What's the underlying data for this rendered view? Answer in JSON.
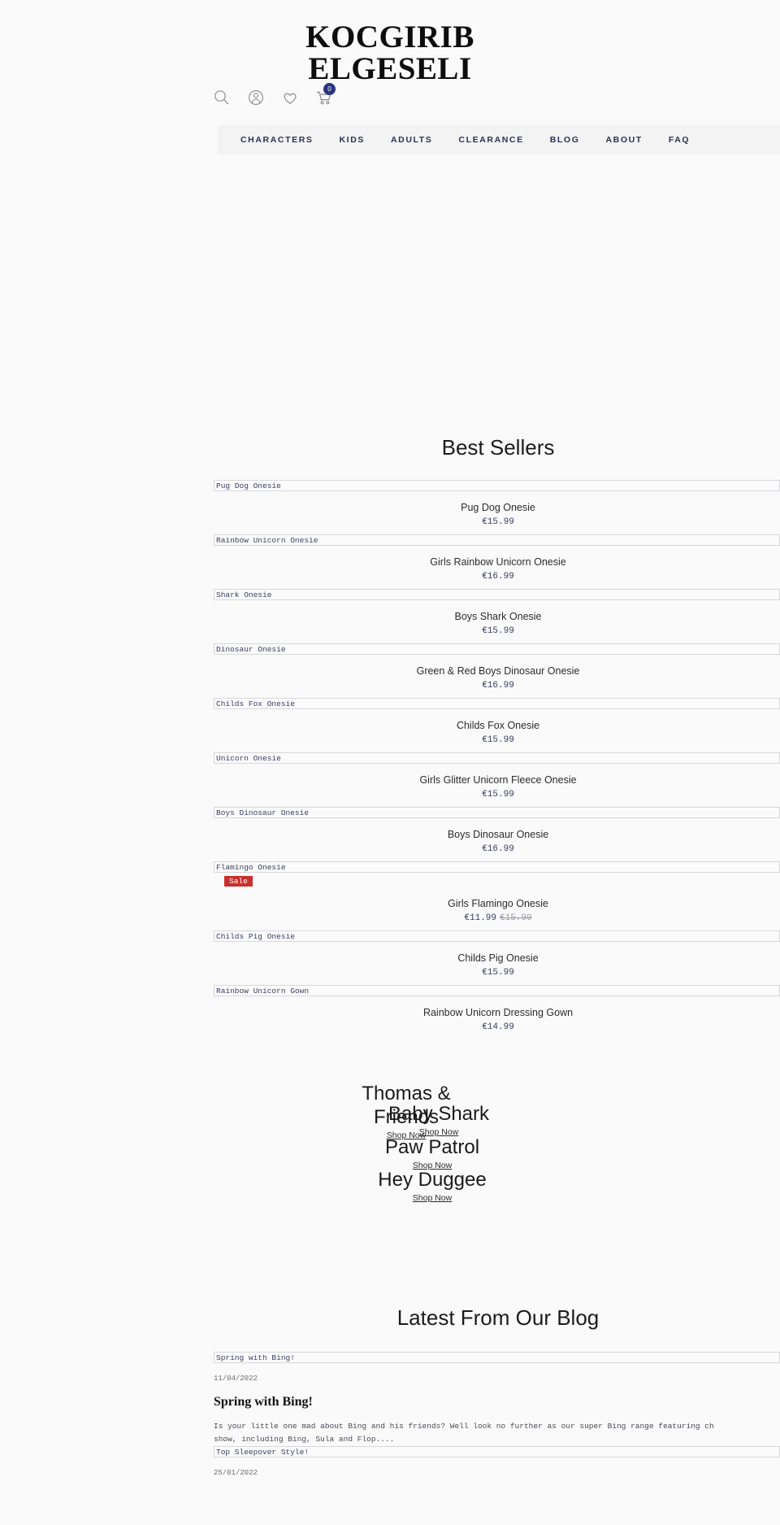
{
  "header": {
    "logo_line1": "KOCGIRIB",
    "logo_line2": "ELGESELI",
    "icons": [
      {
        "name": "search-icon",
        "label": "Search"
      },
      {
        "name": "account-icon",
        "label": "Account"
      },
      {
        "name": "wishlist-heart-icon",
        "label": "Wishlist"
      },
      {
        "name": "shopping-cart-icon",
        "label": "Cart"
      }
    ],
    "cart_count": "0",
    "cart_badge_color": "#2b3480"
  },
  "nav": {
    "items": [
      {
        "label": "CHARACTERS"
      },
      {
        "label": "KIDS"
      },
      {
        "label": "ADULTS"
      },
      {
        "label": "CLEARANCE"
      },
      {
        "label": "BLOG"
      },
      {
        "label": "ABOUT"
      },
      {
        "label": "FAQ"
      }
    ],
    "text_color": "#2b3156",
    "background": "#f3f3f4"
  },
  "best_sellers": {
    "title": "Best Sellers",
    "products": [
      {
        "alt": "Pug Dog Onesie",
        "name": "Pug Dog Onesie",
        "price": "€15.99",
        "old_price": "",
        "sale": false
      },
      {
        "alt": "Rainbow Unicorn Onesie",
        "name": "Girls Rainbow Unicorn Onesie",
        "price": "€16.99",
        "old_price": "",
        "sale": false
      },
      {
        "alt": "Shark Onesie",
        "name": "Boys Shark Onesie",
        "price": "€15.99",
        "old_price": "",
        "sale": false
      },
      {
        "alt": "Dinosaur Onesie",
        "name": "Green & Red Boys Dinosaur Onesie",
        "price": "€16.99",
        "old_price": "",
        "sale": false
      },
      {
        "alt": "Childs Fox Onesie",
        "name": "Childs Fox Onesie",
        "price": "€15.99",
        "old_price": "",
        "sale": false
      },
      {
        "alt": "Unicorn Onesie",
        "name": "Girls Glitter Unicorn Fleece Onesie",
        "price": "€15.99",
        "old_price": "",
        "sale": false
      },
      {
        "alt": "Boys Dinosaur Onesie",
        "name": "Boys Dinosaur Onesie",
        "price": "€16.99",
        "old_price": "",
        "sale": false
      },
      {
        "alt": "Flamingo Onesie",
        "name": "Girls Flamingo Onesie",
        "price": "€11.99",
        "old_price": "€15.99",
        "sale": true,
        "sale_label": "Sale"
      },
      {
        "alt": "Childs Pig Onesie",
        "name": "Childs Pig Onesie",
        "price": "€15.99",
        "old_price": "",
        "sale": false
      },
      {
        "alt": "Rainbow Unicorn Gown",
        "name": "Rainbow Unicorn Dressing Gown",
        "price": "€14.99",
        "old_price": "",
        "sale": false
      }
    ],
    "sale_badge_color": "#c9302c"
  },
  "promos": [
    {
      "title": "Thomas & Friends",
      "cta": "Shop Now"
    },
    {
      "title": "Baby Shark",
      "cta": "Shop Now"
    },
    {
      "title": "Paw Patrol",
      "cta": "Shop Now"
    },
    {
      "title": "Hey Duggee",
      "cta": "Shop Now"
    }
  ],
  "blog": {
    "title": "Latest From Our Blog",
    "posts": [
      {
        "alt": "Spring with Bing!",
        "date": "11/04/2022",
        "heading": "Spring with Bing!",
        "excerpt": "Is your little one mad about Bing and his friends? Well look no further as our super Bing range featuring ch\nshow, including Bing, Sula and Flop...."
      },
      {
        "alt": "Top Sleepover Style!",
        "date": "25/01/2022",
        "heading": "",
        "excerpt": ""
      }
    ]
  }
}
